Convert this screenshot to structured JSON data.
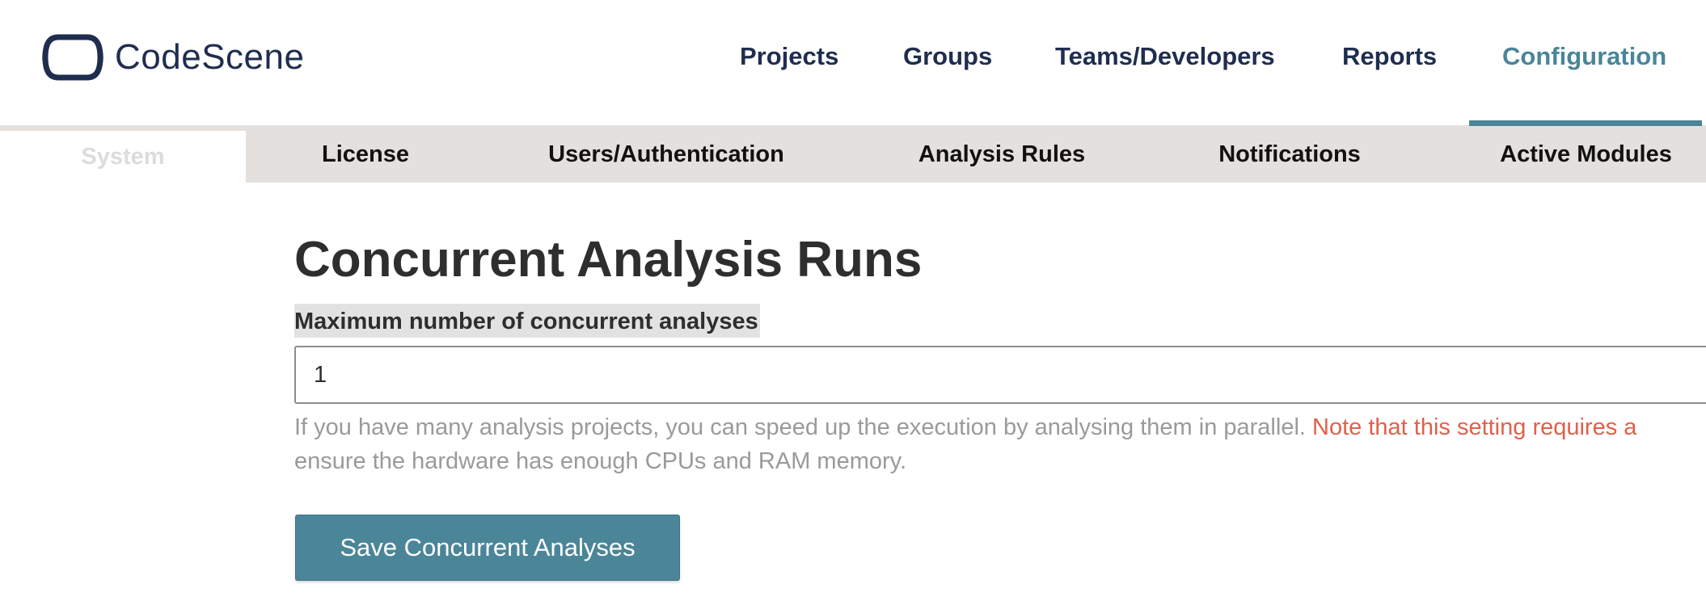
{
  "brand": {
    "name": "CodeScene",
    "logo_icon": "codescene-logo-icon",
    "brand_color": "#1f2d4f",
    "accent_color": "#4b8598"
  },
  "main_nav": {
    "items": [
      {
        "label": "Projects"
      },
      {
        "label": "Groups"
      },
      {
        "label": "Teams/Developers"
      },
      {
        "label": "Reports"
      },
      {
        "label": "Configuration",
        "active": true
      }
    ]
  },
  "sub_nav": {
    "items": [
      {
        "label": "System",
        "active": true
      },
      {
        "label": "License"
      },
      {
        "label": "Users/Authentication"
      },
      {
        "label": "Analysis Rules"
      },
      {
        "label": "Notifications"
      },
      {
        "label": "Active Modules"
      }
    ]
  },
  "section": {
    "title": "Concurrent Analysis Runs",
    "field_label": "Maximum number of concurrent analyses",
    "field_value": "1",
    "help_text_part1": "If you have many analysis projects, you can speed up the execution by analysing them in parallel.",
    "help_text_note": "Note that this setting requires a",
    "help_text_line2": "ensure the hardware has enough CPUs and RAM memory.",
    "note_color": "#e0604a",
    "save_label": "Save Concurrent Analyses"
  }
}
